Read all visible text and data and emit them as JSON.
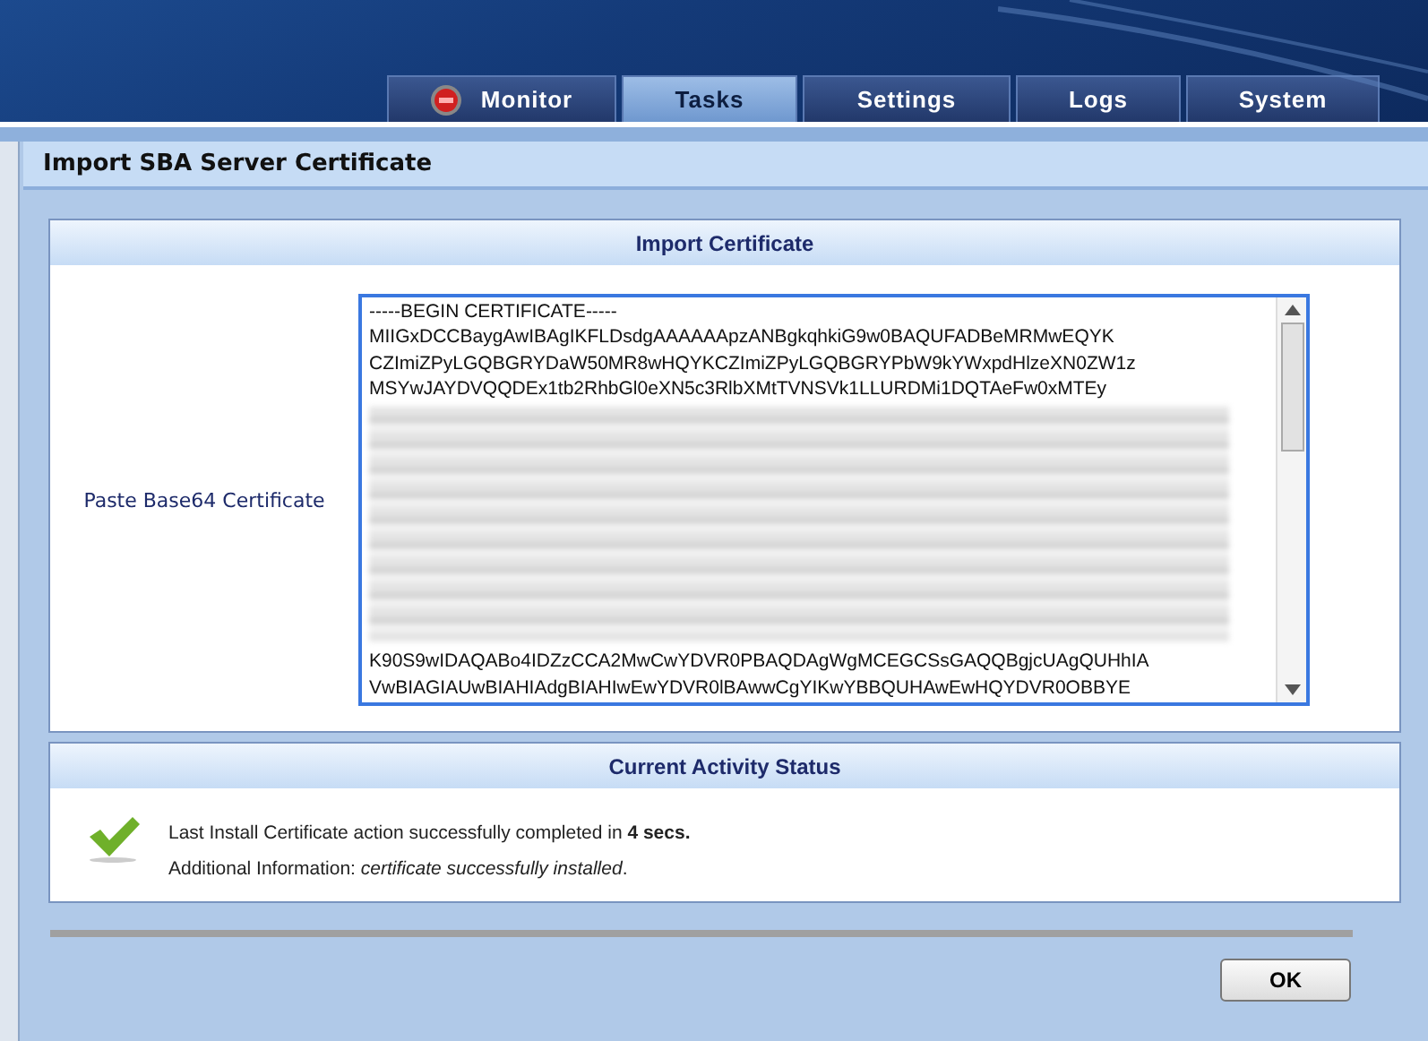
{
  "tabs": [
    {
      "label": "Monitor",
      "selected": false,
      "kind": "status"
    },
    {
      "label": "Tasks",
      "selected": true,
      "kind": "plain"
    },
    {
      "label": "Settings",
      "selected": false,
      "kind": "plain"
    },
    {
      "label": "Logs",
      "selected": false,
      "kind": "plain"
    },
    {
      "label": "System",
      "selected": false,
      "kind": "plain"
    }
  ],
  "page_title": "Import SBA Server Certificate",
  "import_panel": {
    "title": "Import Certificate",
    "label": "Paste Base64 Certificate",
    "certificate_lines_top": [
      "-----BEGIN CERTIFICATE-----",
      "MIIGxDCCBaygAwIBAgIKFLDsdgAAAAAApzANBgkqhkiG9w0BAQUFADBeMRMwEQYK",
      "CZImiZPyLGQBGRYDaW50MR8wHQYKCZImiZPyLGQBGRYPbW9kYWxpdHlzeXN0ZW1z",
      "MSYwJAYDVQQDEx1tb2RhbGl0eXN5c3RlbXMtTVNSVk1LLURDMi1DQTAeFw0xMTEy"
    ],
    "certificate_lines_bottom": [
      "K90S9wIDAQABo4IDZzCCA2MwCwYDVR0PBAQDAgWgMCEGCSsGAQQBgjcUAgQUHhIA",
      "VwBIAGIAUwBIAHIAdgBIAHIwEwYDVR0lBAwwCgYIKwYBBQUHAwEwHQYDVR0OBBYE"
    ]
  },
  "status_panel": {
    "title": "Current Activity Status",
    "message": "Last Install Certificate action successfully completed in **4 secs.**",
    "additional": "Additional Information: *certificate successfully installed*."
  },
  "buttons": [
    "OK"
  ]
}
